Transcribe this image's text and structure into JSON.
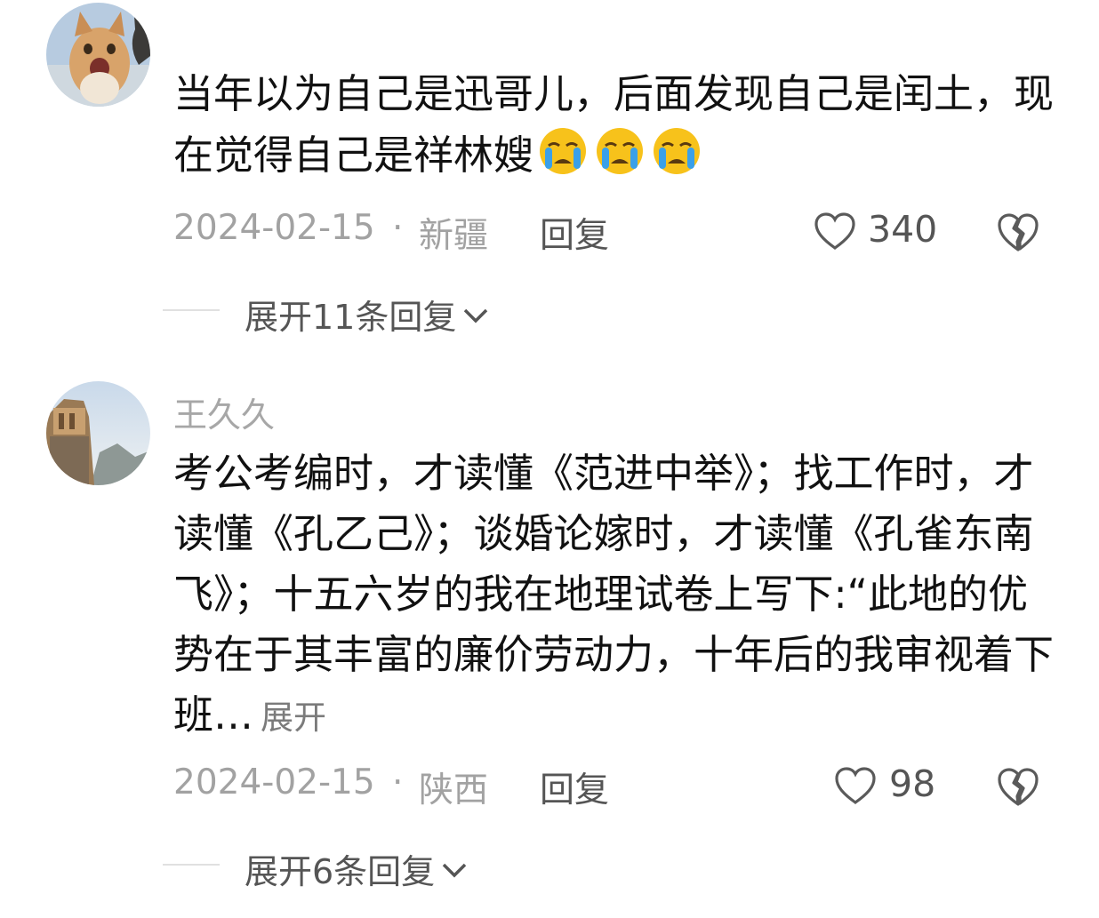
{
  "comments": [
    {
      "username": "",
      "text": "当年以为自己是迅哥儿，后面发现自己是闰土，现在觉得自己是祥林嫂",
      "emojis": [
        "crying-face-icon",
        "crying-face-icon",
        "crying-face-icon"
      ],
      "date": "2024-02-15",
      "dot": "·",
      "region": "新疆",
      "reply_label": "回复",
      "likes": "340",
      "expand_label": "展开11条回复"
    },
    {
      "username": "王久久",
      "text": "考公考编时，才读懂《范进中举》；找工作时，才读懂《孔乙己》；谈婚论嫁时，才读懂《孔雀东南飞》；十五六岁的我在地理试卷上写下:“此地的优势在于其丰富的廉价劳动力，十年后的我审视着下班…",
      "more_label": "展开",
      "date": "2024-02-15",
      "dot": "·",
      "region": "陕西",
      "reply_label": "回复",
      "likes": "98",
      "expand_label": "展开6条回复"
    }
  ],
  "colors": {
    "text_primary": "#111111",
    "text_meta": "#a2a2a2",
    "text_secondary": "#555555",
    "emoji_yellow": "#f7c21b",
    "emoji_tear": "#3aa0e8"
  }
}
